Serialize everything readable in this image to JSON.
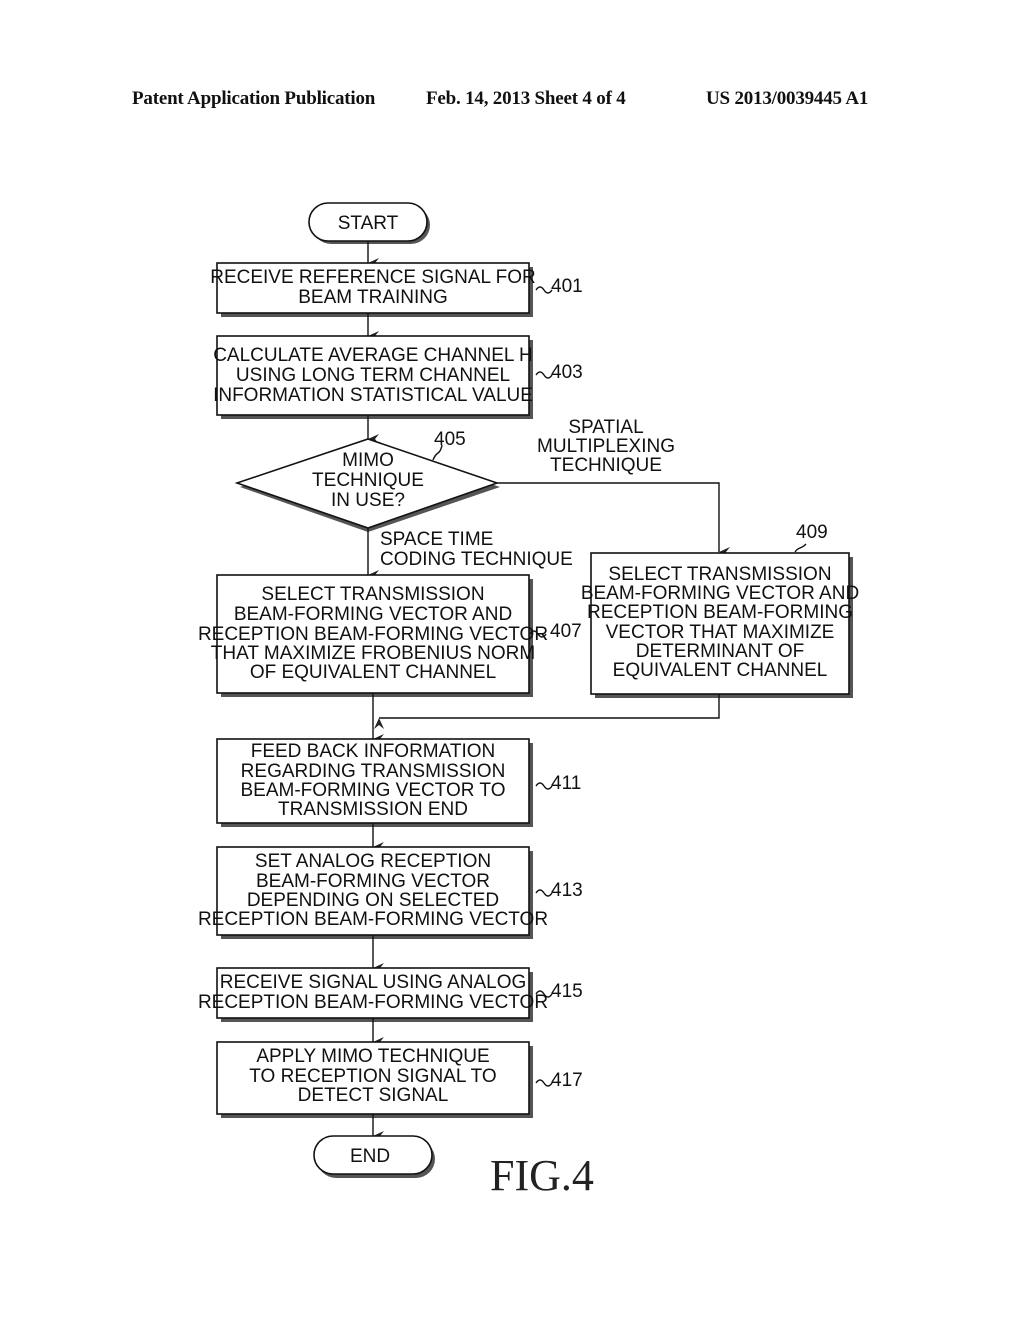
{
  "header": {
    "publication": "Patent Application Publication",
    "date_sheet": "Feb. 14, 2013   Sheet 4 of 4",
    "number": "US 2013/0039445 A1"
  },
  "figure_label": "FIG.4",
  "flowchart": {
    "start": "START",
    "end": "END",
    "steps": {
      "s401": {
        "ref": "401",
        "lines": [
          "RECEIVE REFERENCE SIGNAL FOR",
          "BEAM TRAINING"
        ]
      },
      "s403": {
        "ref": "403",
        "lines": [
          "CALCULATE AVERAGE CHANNEL H",
          "USING LONG TERM CHANNEL",
          "INFORMATION STATISTICAL VALUE"
        ]
      },
      "s405": {
        "ref": "405",
        "lines": [
          "MIMO",
          "TECHNIQUE",
          "IN USE?"
        ]
      },
      "s407": {
        "ref": "407",
        "lines": [
          "SELECT TRANSMISSION",
          "BEAM-FORMING VECTOR AND",
          "RECEPTION BEAM-FORMING VECTOR",
          "THAT MAXIMIZE FROBENIUS NORM",
          "OF EQUIVALENT CHANNEL"
        ]
      },
      "s409": {
        "ref": "409",
        "lines": [
          "SELECT TRANSMISSION",
          "BEAM-FORMING VECTOR AND",
          "RECEPTION BEAM-FORMING",
          "VECTOR THAT MAXIMIZE",
          "DETERMINANT OF",
          "EQUIVALENT CHANNEL"
        ]
      },
      "s411": {
        "ref": "411",
        "lines": [
          "FEED BACK INFORMATION",
          "REGARDING TRANSMISSION",
          "BEAM-FORMING VECTOR TO",
          "TRANSMISSION END"
        ]
      },
      "s413": {
        "ref": "413",
        "lines": [
          "SET ANALOG RECEPTION",
          "BEAM-FORMING VECTOR",
          "DEPENDING ON SELECTED",
          "RECEPTION BEAM-FORMING VECTOR"
        ]
      },
      "s415": {
        "ref": "415",
        "lines": [
          "RECEIVE SIGNAL USING ANALOG",
          "RECEPTION BEAM-FORMING VECTOR"
        ]
      },
      "s417": {
        "ref": "417",
        "lines": [
          "APPLY MIMO TECHNIQUE",
          "TO RECEPTION SIGNAL TO",
          "DETECT SIGNAL"
        ]
      }
    },
    "branches": {
      "spatial": [
        "SPATIAL",
        "MULTIPLEXING",
        "TECHNIQUE"
      ],
      "stc": [
        "SPACE TIME",
        "CODING TECHNIQUE"
      ]
    }
  }
}
